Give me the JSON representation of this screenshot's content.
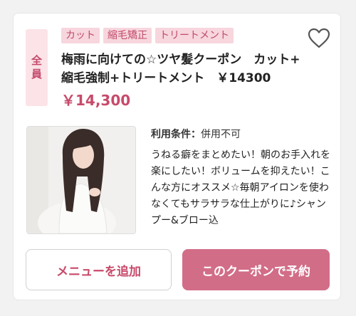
{
  "coupon": {
    "badge_line1": "全",
    "badge_line2": "員",
    "tags": [
      "カット",
      "縮毛矯正",
      "トリートメント"
    ],
    "title": "梅雨に向けての☆ツヤ髪クーポン　カット+\n縮毛強制+トリートメント　￥14300",
    "price": "￥14,300",
    "favorite_icon": "heart-outline-icon",
    "terms_label": "利用条件：",
    "terms_value": "併用不可",
    "description": "うねる癖をまとめたい！朝のお手入れを楽にしたい！ボリュームを抑えたい！こんな方にオススメ☆毎朝アイロンを使わなくてもサラサラな仕上がりに♪シャンプー&ブロー込"
  },
  "buttons": {
    "add_menu": "メニューを追加",
    "book_coupon": "このクーポンで予約"
  },
  "colors": {
    "accent": "#c74a6a",
    "tag_bg": "#f7d6de",
    "book_button_bg": "#d26d87"
  }
}
